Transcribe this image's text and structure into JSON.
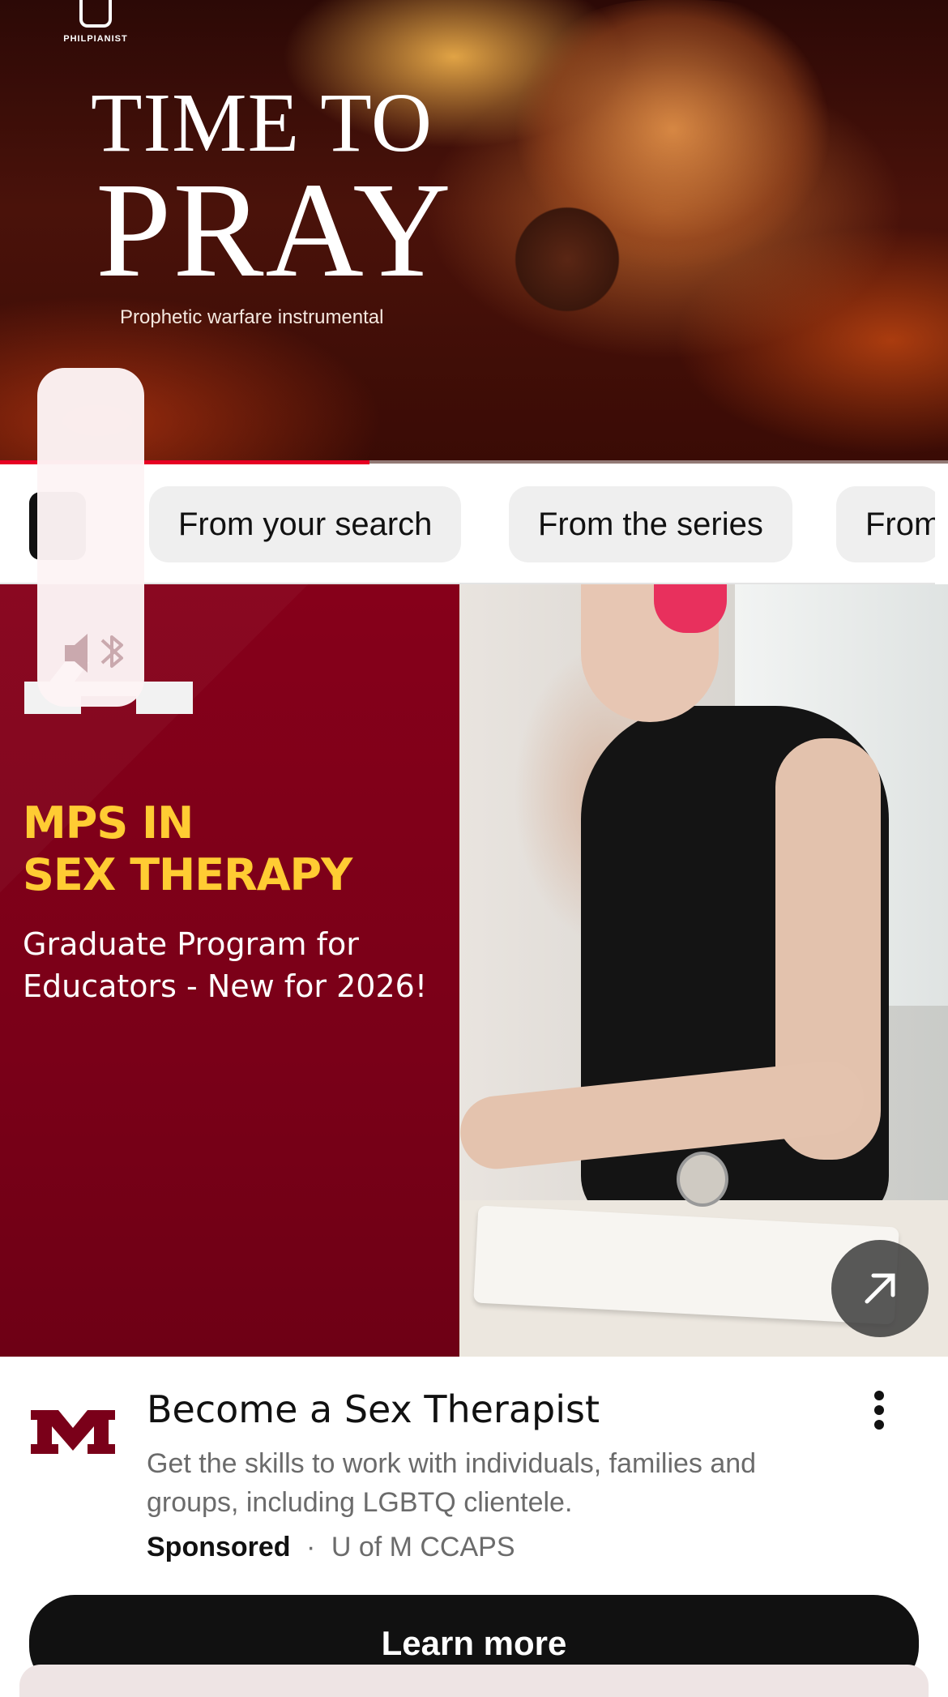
{
  "hero": {
    "logo_text": "PHILPIANIST",
    "title_line1": "TIME TO",
    "title_line2": "PRAY",
    "subtitle": "Prophetic warfare instrumental",
    "progress": 0.39
  },
  "chips": [
    {
      "label": "From your search"
    },
    {
      "label": "From the series"
    },
    {
      "label": "From"
    }
  ],
  "overlay": {
    "icon": "speaker-bluetooth-icon"
  },
  "ad": {
    "image_headline_line1": "MPS IN",
    "image_headline_line2": "SEX THERAPY",
    "image_sub_line1": "Graduate Program for",
    "image_sub_line2": "Educators - New for 2026!",
    "title": "Become a Sex Therapist",
    "description": "Get the skills to work with individuals, families and groups, including LGBTQ clientele.",
    "sponsored_label": "Sponsored",
    "separator": "·",
    "advertiser": "U of M CCAPS",
    "cta_label": "Learn more"
  },
  "colors": {
    "brand_maroon": "#7a0019",
    "gold": "#ffcc33",
    "progress_red": "#e60023",
    "cta_bg": "#111111"
  }
}
